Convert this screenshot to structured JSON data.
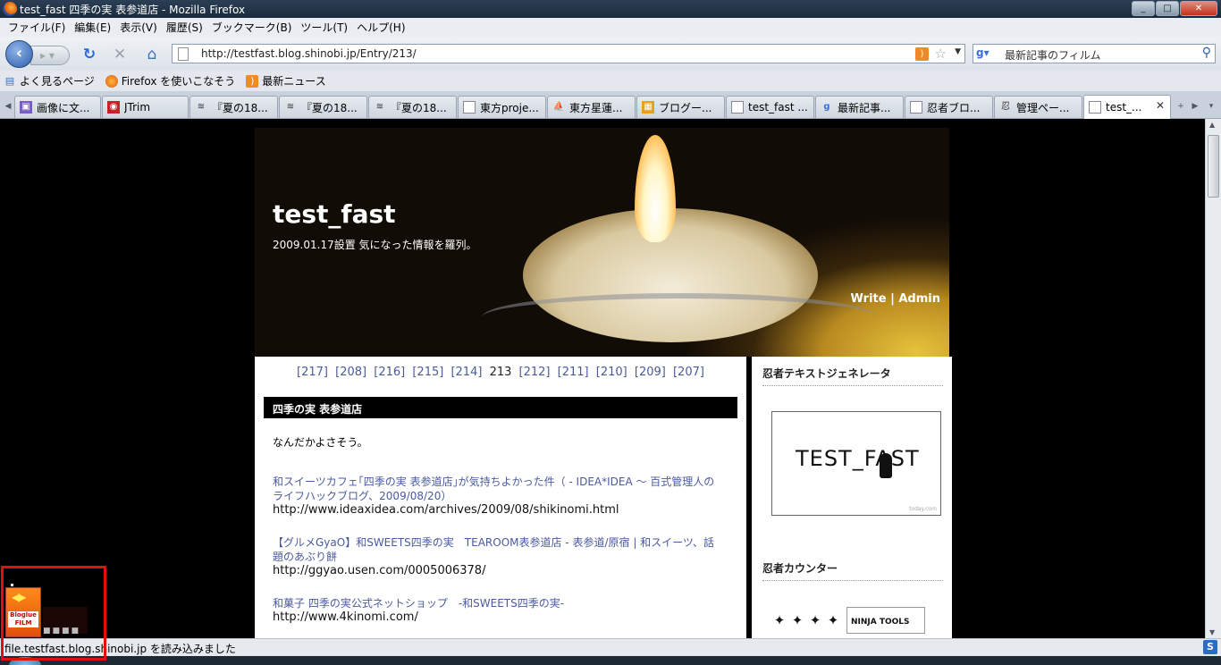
{
  "window": {
    "title": "test_fast 四季の実 表参道店 - Mozilla Firefox",
    "min": "_",
    "max": "□",
    "close": "✕"
  },
  "menu": [
    "ファイル(F)",
    "編集(E)",
    "表示(V)",
    "履歴(S)",
    "ブックマーク(B)",
    "ツール(T)",
    "ヘルプ(H)"
  ],
  "nav": {
    "url": "http://testfast.blog.shinobi.jp/Entry/213/",
    "search_engine": "google-icon",
    "search_text": "最新記事のフィルム"
  },
  "bookmarks": [
    {
      "label": "よく見るページ",
      "icon": "magnifier-page-icon"
    },
    {
      "label": "Firefox を使いこなそう",
      "icon": "firefox-icon"
    },
    {
      "label": "最新ニュース",
      "icon": "rss-icon"
    }
  ],
  "tabs": [
    {
      "label": "画像に文...",
      "icon": "purple-app-icon",
      "color": "#7a5cc8"
    },
    {
      "label": "JTrim",
      "icon": "jtrim-icon",
      "color": "#c8202a"
    },
    {
      "label": "『夏の18...",
      "icon": "waves-icon",
      "color": "#333333"
    },
    {
      "label": "『夏の18...",
      "icon": "waves-icon",
      "color": "#333333"
    },
    {
      "label": "『夏の18...",
      "icon": "waves-icon",
      "color": "#333333"
    },
    {
      "label": "東方proje...",
      "icon": "page-icon",
      "color": "#ffffff"
    },
    {
      "label": "東方星蓮...",
      "icon": "ship-icon",
      "color": "#555555"
    },
    {
      "label": "ブログー...",
      "icon": "grid-icon",
      "color": "#e8a020"
    },
    {
      "label": "test_fast ...",
      "icon": "page-icon",
      "color": "#ffffff"
    },
    {
      "label": "最新記事...",
      "icon": "google-icon",
      "color": "#3b6fd8"
    },
    {
      "label": "忍者ブロ...",
      "icon": "page-icon",
      "color": "#ffffff"
    },
    {
      "label": "管理ペー...",
      "icon": "ninja-icon",
      "color": "#333333"
    },
    {
      "label": "test_...",
      "icon": "page-icon",
      "color": "#ffffff",
      "active": true
    }
  ],
  "blog": {
    "title": "test_fast",
    "subtitle": "2009.01.17設置 気になった情報を羅列。",
    "write": "Write",
    "sep": "|",
    "admin": "Admin"
  },
  "pager": {
    "items": [
      "[217]",
      "[208]",
      "[216]",
      "[215]",
      "[214]",
      "213",
      "[212]",
      "[211]",
      "[210]",
      "[209]",
      "[207]"
    ],
    "current_index": 5
  },
  "entry": {
    "title": "四季の実 表参道店",
    "intro": "なんだかよさそう。",
    "refs": [
      {
        "link": "和スイーツカフェ｢四季の実 表参道店｣が気持ちよかった件（ - IDEA*IDEA 〜 百式管理人のライフハックブログ、2009/08/20）",
        "url": "http://www.ideaxidea.com/archives/2009/08/shikinomi.html"
      },
      {
        "link": "【グルメGyaO】和SWEETS四季の実　TEAROOM表参道店 - 表参道/原宿 | 和スイーツ、話題のあぶり餅",
        "url": "http://ggyao.usen.com/0005006378/"
      },
      {
        "link": "和菓子 四季の実公式ネットショップ　-和SWEETS四季の実-",
        "url": "http://www.4kinomi.com/"
      }
    ]
  },
  "sidebar": {
    "text_gen_title": "忍者テキストジェネレータ",
    "text_gen_image_text": "TEST_FAST",
    "text_gen_footer": "today.com",
    "counter_title": "忍者カウンター",
    "ninja_tools": "NINJA TOOLS"
  },
  "bloglue": {
    "label": "Bloglue FILM"
  },
  "status": {
    "text": "file.testfast.blog.shinobi.jp を読み込みました",
    "addon_icon": "S"
  }
}
